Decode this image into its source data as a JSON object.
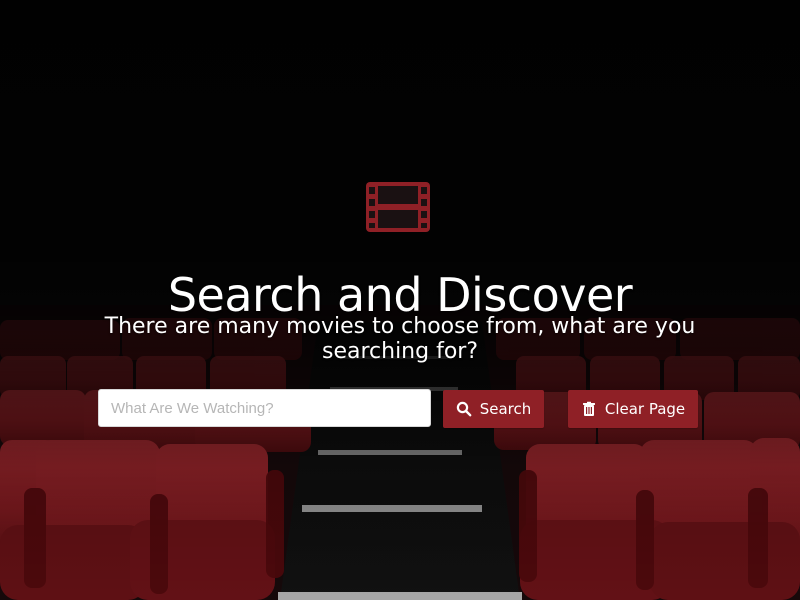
{
  "hero": {
    "title": "Search and Discover",
    "subtitle": "There are many movies to choose from, what are you searching for?",
    "icon": "film-icon",
    "accent_color": "#8f2026",
    "text_color": "#ffffff"
  },
  "search": {
    "placeholder": "What Are We Watching?",
    "value": "",
    "search_button_label": "Search",
    "search_button_icon": "search-icon",
    "clear_button_label": "Clear Page",
    "clear_button_icon": "trash-icon"
  }
}
